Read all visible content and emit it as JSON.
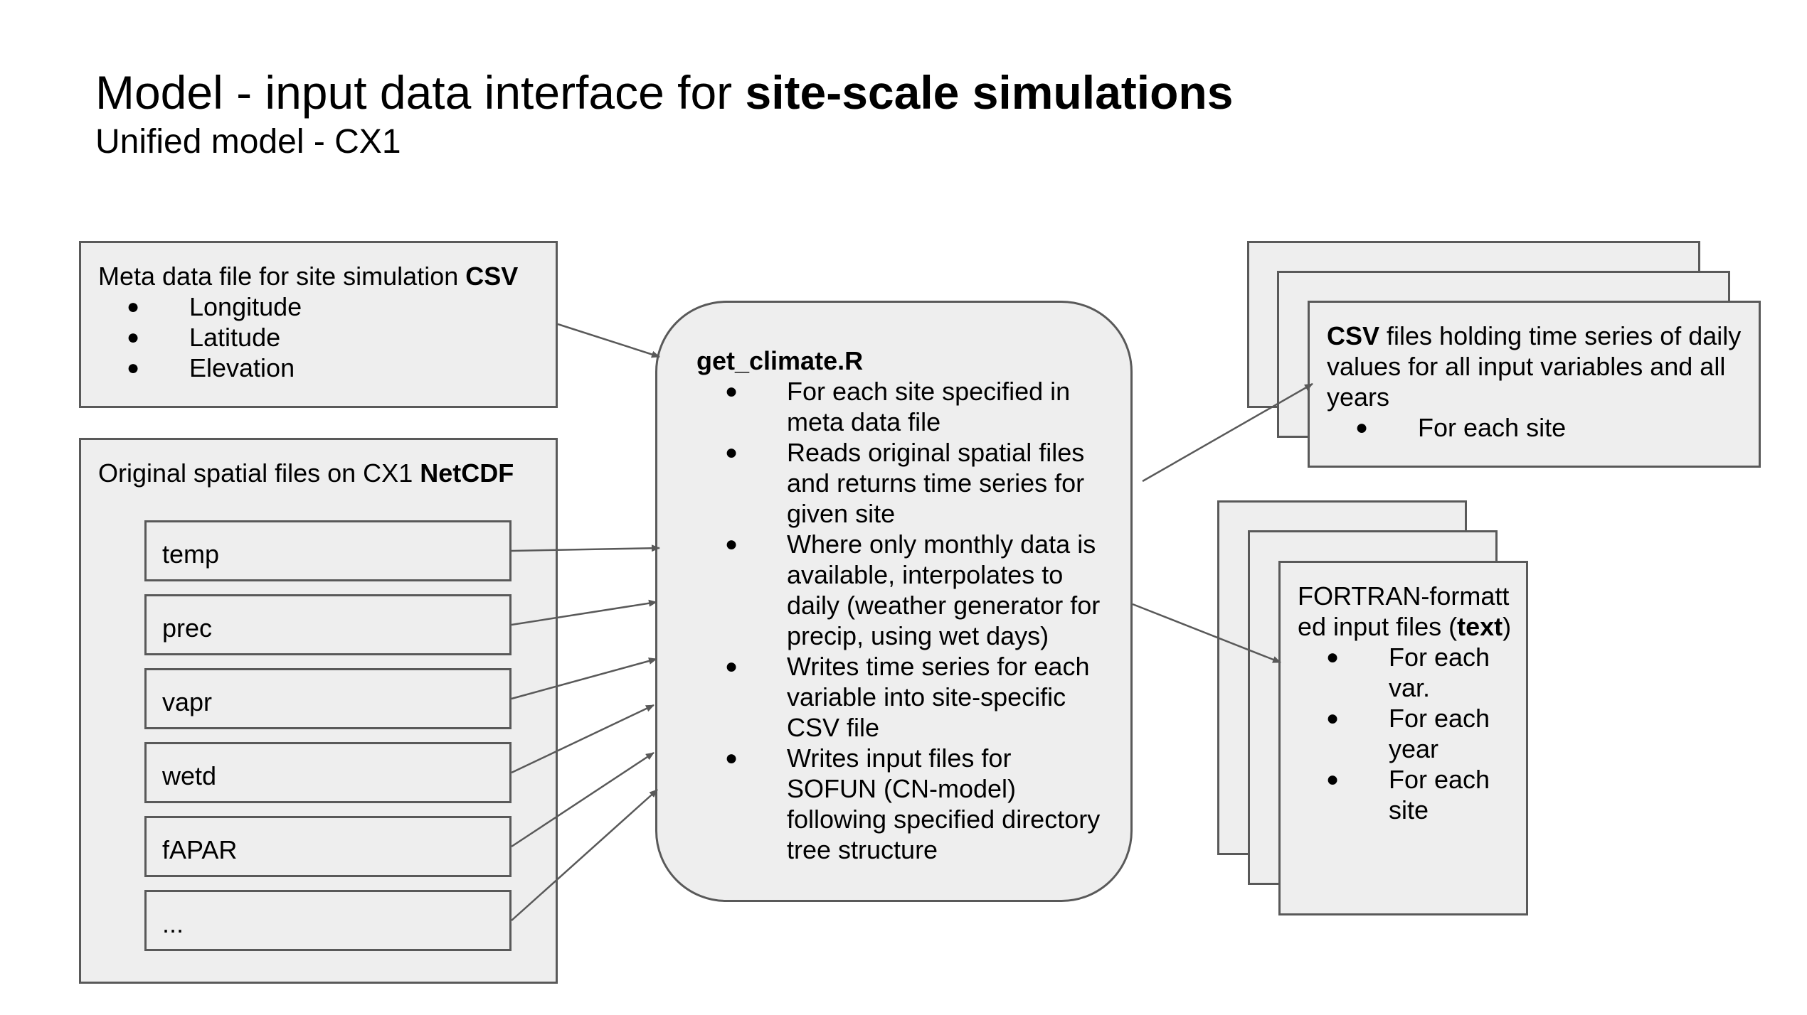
{
  "title": {
    "prefix": "Model - input data interface for ",
    "bold": "site-scale simulations",
    "subtitle": "Unified model - CX1"
  },
  "meta_box": {
    "label": "Meta data file for site simulation ",
    "label_bold": "CSV",
    "items": [
      "Longitude",
      "Latitude",
      "Elevation"
    ]
  },
  "spatial_box": {
    "label": "Original spatial files on CX1 ",
    "label_bold": "NetCDF",
    "files": [
      "temp",
      "prec",
      "vapr",
      "wetd",
      "fAPAR",
      "..."
    ]
  },
  "script_box": {
    "name": "get_climate.R",
    "items": [
      "For each site specified in meta data file",
      "Reads original spatial files and returns time series for given site",
      "Where only monthly data is available, interpolates to daily (weather generator for precip, using wet days)",
      "Writes time series for each variable into site-specific CSV file",
      "Writes input files for SOFUN (CN-model) following specified directory tree structure"
    ]
  },
  "csv_output": {
    "label_bold": "CSV",
    "label": " files holding time series of daily values for all input variables and all years",
    "items": [
      "For each site"
    ]
  },
  "fortran_output": {
    "label": "FORTRAN-formatted input files (",
    "label_bold": "text",
    "label_end": ")",
    "items": [
      "For each var.",
      "For each year",
      "For each site"
    ]
  },
  "colors": {
    "box_fill": "#eeeeee",
    "box_border": "#595959",
    "arrow": "#595959"
  }
}
